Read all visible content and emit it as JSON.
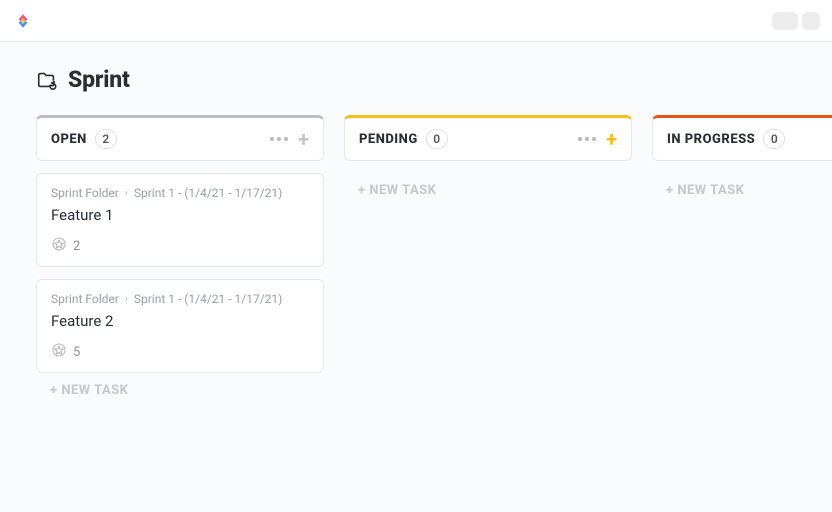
{
  "page": {
    "title": "Sprint"
  },
  "board": {
    "newTaskLabel": "+ NEW TASK",
    "columns": [
      {
        "label": "OPEN",
        "count": 2,
        "accent": "gray",
        "showActions": true,
        "plusColor": "gray"
      },
      {
        "label": "PENDING",
        "count": 0,
        "accent": "yellow",
        "showActions": true,
        "plusColor": "yellow"
      },
      {
        "label": "IN PROGRESS",
        "count": 0,
        "accent": "orange",
        "showActions": false
      }
    ]
  },
  "cards": [
    {
      "breadcrumbFolder": "Sprint Folder",
      "breadcrumbSprint": "Sprint 1 - (1/4/21 - 1/17/21)",
      "title": "Feature 1",
      "points": 2
    },
    {
      "breadcrumbFolder": "Sprint Folder",
      "breadcrumbSprint": "Sprint 1 - (1/4/21 - 1/17/21)",
      "title": "Feature 2",
      "points": 5
    }
  ]
}
